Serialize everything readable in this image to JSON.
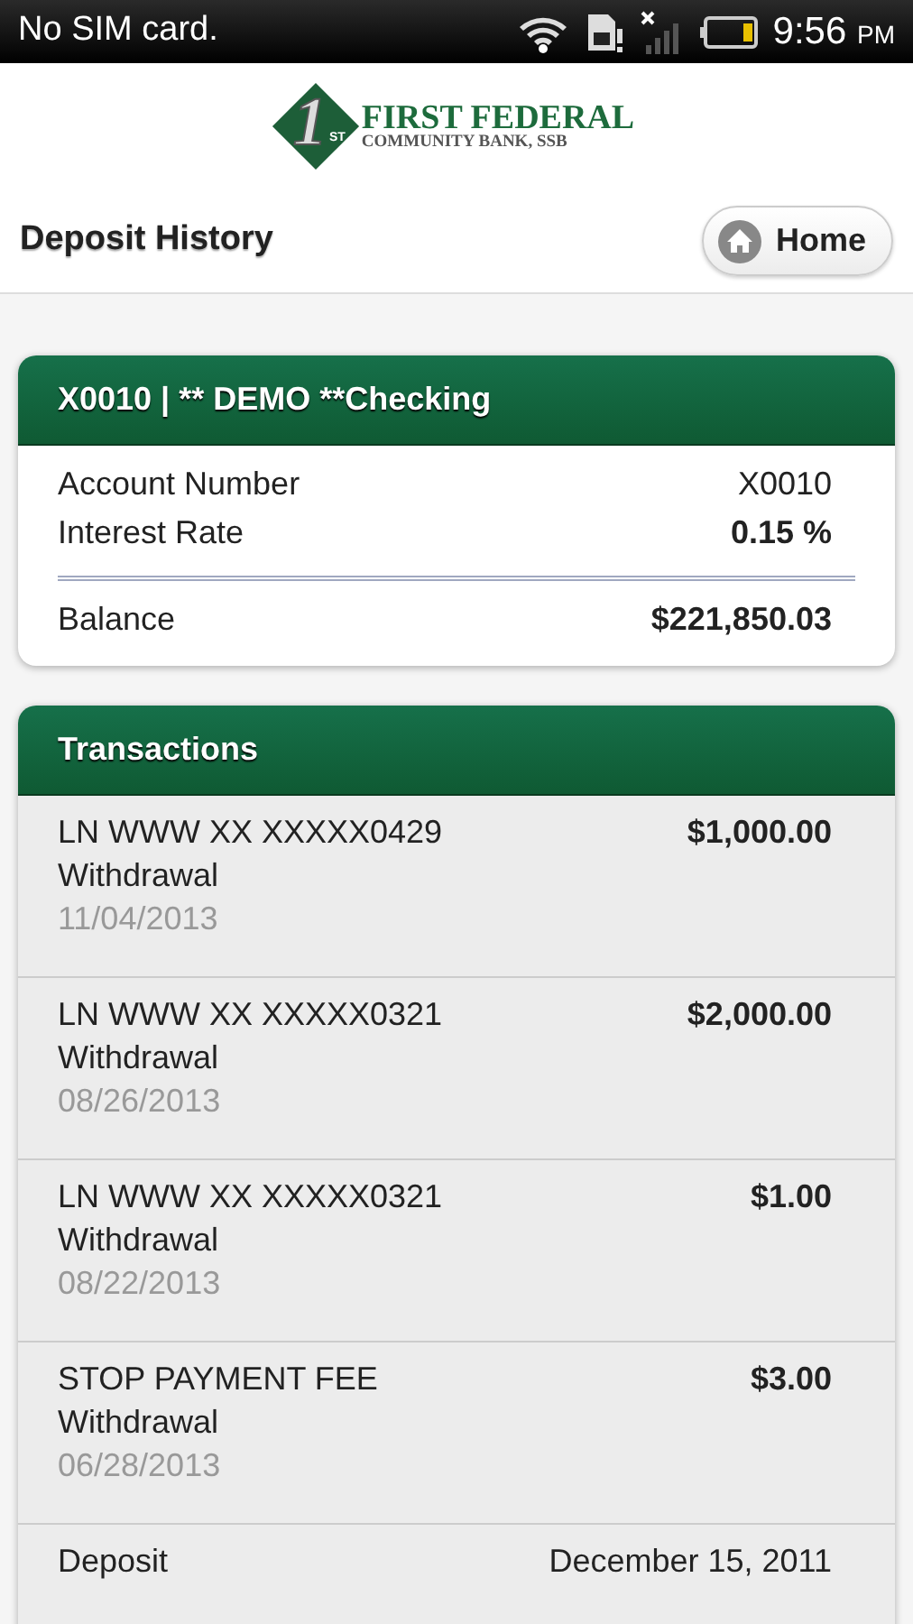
{
  "status_bar": {
    "carrier": "No SIM card.",
    "time": "9:56",
    "meridiem": "PM"
  },
  "logo": {
    "mark": "1",
    "mark_suffix": "ST",
    "name": "FIRST FEDERAL",
    "subtitle": "COMMUNITY BANK, SSB"
  },
  "header": {
    "title": "Deposit History",
    "home_button": "Home"
  },
  "account": {
    "title": "X0010 | ** DEMO **Checking",
    "rows": [
      {
        "label": "Account Number",
        "value": "X0010",
        "bold": false
      },
      {
        "label": "Interest Rate",
        "value": "0.15 %",
        "bold": true
      }
    ],
    "balance": {
      "label": "Balance",
      "value": "$221,850.03"
    }
  },
  "transactions": {
    "title": "Transactions",
    "items": [
      {
        "kind": "withdrawal",
        "description": "LN WWW XX XXXXX0429",
        "type": "Withdrawal",
        "date": "11/04/2013",
        "amount": "$1,000.00"
      },
      {
        "kind": "withdrawal",
        "description": "LN WWW XX XXXXX0321",
        "type": "Withdrawal",
        "date": "08/26/2013",
        "amount": "$2,000.00"
      },
      {
        "kind": "withdrawal",
        "description": "LN WWW XX XXXXX0321",
        "type": "Withdrawal",
        "date": "08/22/2013",
        "amount": "$1.00"
      },
      {
        "kind": "withdrawal",
        "description": "STOP PAYMENT FEE",
        "type": "Withdrawal",
        "date": "06/28/2013",
        "amount": "$3.00"
      },
      {
        "kind": "deposit",
        "type": "Deposit",
        "date": "December 15, 2011"
      }
    ]
  }
}
